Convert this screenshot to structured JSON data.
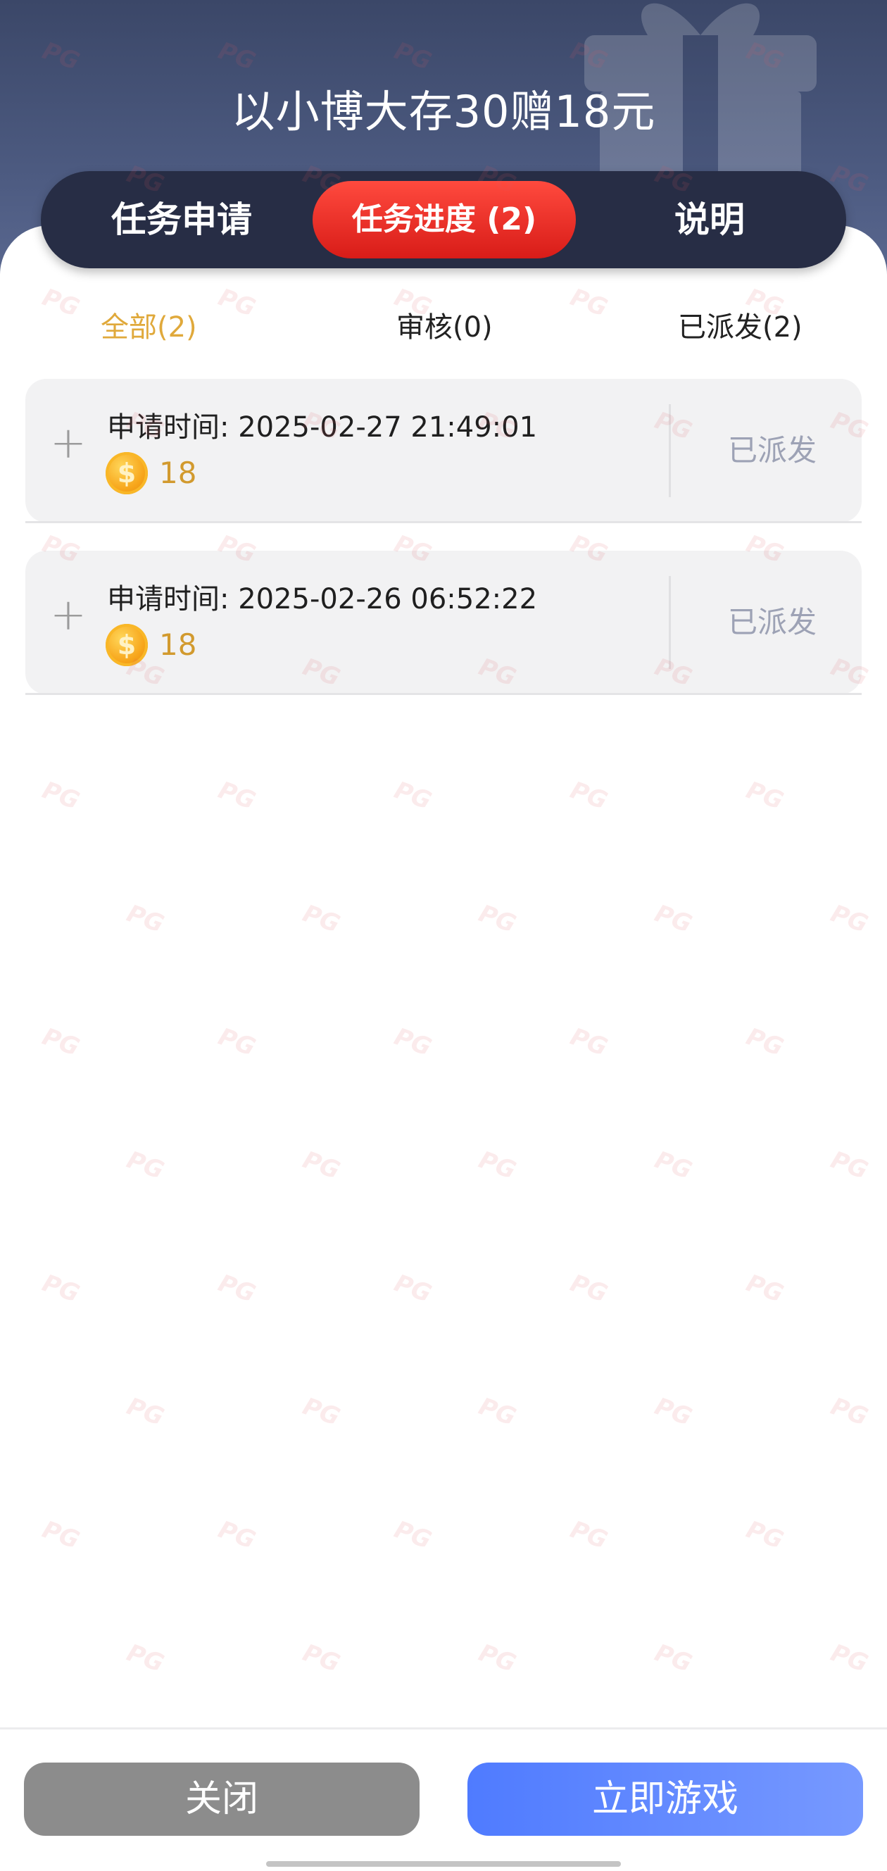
{
  "header": {
    "title": "以小博大存30赠18元"
  },
  "tabs": [
    {
      "label": "任务申请"
    },
    {
      "label": "任务进度 (2)"
    },
    {
      "label": "说明"
    }
  ],
  "filters": [
    {
      "label": "全部(2)"
    },
    {
      "label": "审核(0)"
    },
    {
      "label": "已派发(2)"
    }
  ],
  "records": [
    {
      "time_label": "申请时间: 2025-02-27 21:49:01",
      "amount": "18",
      "status": "已派发"
    },
    {
      "time_label": "申请时间: 2025-02-26 06:52:22",
      "amount": "18",
      "status": "已派发"
    }
  ],
  "footer": {
    "close_label": "关闭",
    "play_label": "立即游戏"
  },
  "watermark": "PG",
  "colors": {
    "header_bg": "#3b4768",
    "tab_bar_bg": "#272d45",
    "tab_active": "#e0221d",
    "filter_active": "#e0a93b",
    "status_text": "#9da2b5",
    "close_button": "#8c8c8c",
    "play_button": "#5a84ff"
  }
}
